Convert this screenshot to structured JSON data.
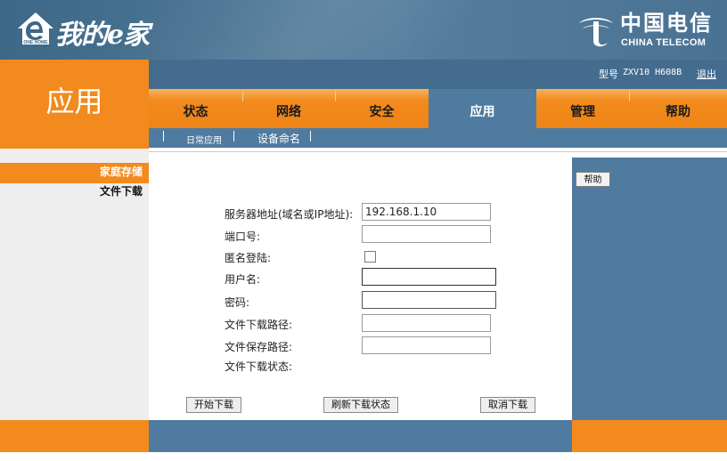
{
  "header": {
    "logo_text": "我的e家",
    "logo_house_text": "ONE HOME",
    "brand_cn": "中国电信",
    "brand_en": "CHINA TELECOM"
  },
  "section_title": "应用",
  "model_bar": {
    "model_label": "型号",
    "model_value": "ZXV10 H608B",
    "logout": "退出"
  },
  "tabs": [
    {
      "label": "状态",
      "active": false
    },
    {
      "label": "网络",
      "active": false
    },
    {
      "label": "安全",
      "active": false
    },
    {
      "label": "应用",
      "active": true
    },
    {
      "label": "管理",
      "active": false
    },
    {
      "label": "帮助",
      "active": false
    }
  ],
  "subnav": {
    "items": [
      "日常应用",
      "设备命名"
    ]
  },
  "left_nav": {
    "items": [
      {
        "label": "家庭存储",
        "active": true
      },
      {
        "label": "文件下载",
        "active": false
      }
    ]
  },
  "help_button": "帮助",
  "form": {
    "server_address_label": "服务器地址(域名或IP地址):",
    "server_address_value": "192.168.1.10",
    "port_label": "端口号:",
    "port_value": "",
    "anonymous_label": "匿名登陆:",
    "anonymous_checked": false,
    "username_label": "用户名:",
    "username_value": "",
    "password_label": "密码:",
    "password_value": "",
    "download_path_label": "文件下载路径:",
    "download_path_value": "",
    "save_path_label": "文件保存路径:",
    "save_path_value": "",
    "status_label": "文件下载状态:"
  },
  "buttons": {
    "start": "开始下载",
    "refresh": "刷新下载状态",
    "cancel": "取消下载"
  },
  "colors": {
    "orange": "#f28a1d",
    "blue": "#4f7ba0",
    "header_blue": "#3d6887"
  }
}
